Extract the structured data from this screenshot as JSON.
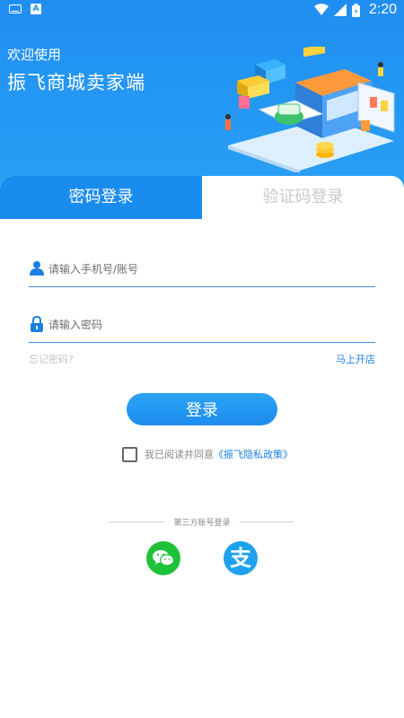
{
  "status_bar": {
    "time": "2:20",
    "left_icons": [
      "keyboard-icon",
      "a-notification-icon"
    ],
    "right_icons": [
      "wifi-icon",
      "signal-icon",
      "battery-icon"
    ]
  },
  "header": {
    "welcome": "欢迎使用",
    "app_name": "振飞商城卖家端",
    "illustration": "shop-isometric-illustration"
  },
  "tabs": [
    {
      "label": "密码登录",
      "active": true
    },
    {
      "label": "验证码登录",
      "active": false
    }
  ],
  "form": {
    "account_placeholder": "请输入手机号/账号",
    "password_placeholder": "请输入密码",
    "account_icon": "user-icon",
    "password_icon": "lock-icon",
    "forgot_label": "忘记密码?",
    "open_store_label": "马上开店",
    "login_label": "登录"
  },
  "agreement": {
    "text": "我已阅读并同意",
    "link": "《振飞隐私政策》",
    "checked": false
  },
  "third_party": {
    "label": "第三方账号登录",
    "providers": [
      {
        "name": "wechat-icon"
      },
      {
        "name": "alipay-icon",
        "glyph": "支"
      }
    ]
  },
  "colors": {
    "primary": "#1a8cf0",
    "header_bg": "#1f8ef1",
    "link": "#1a7fe0",
    "wechat": "#1ec23a",
    "alipay": "#1ea2ee"
  }
}
